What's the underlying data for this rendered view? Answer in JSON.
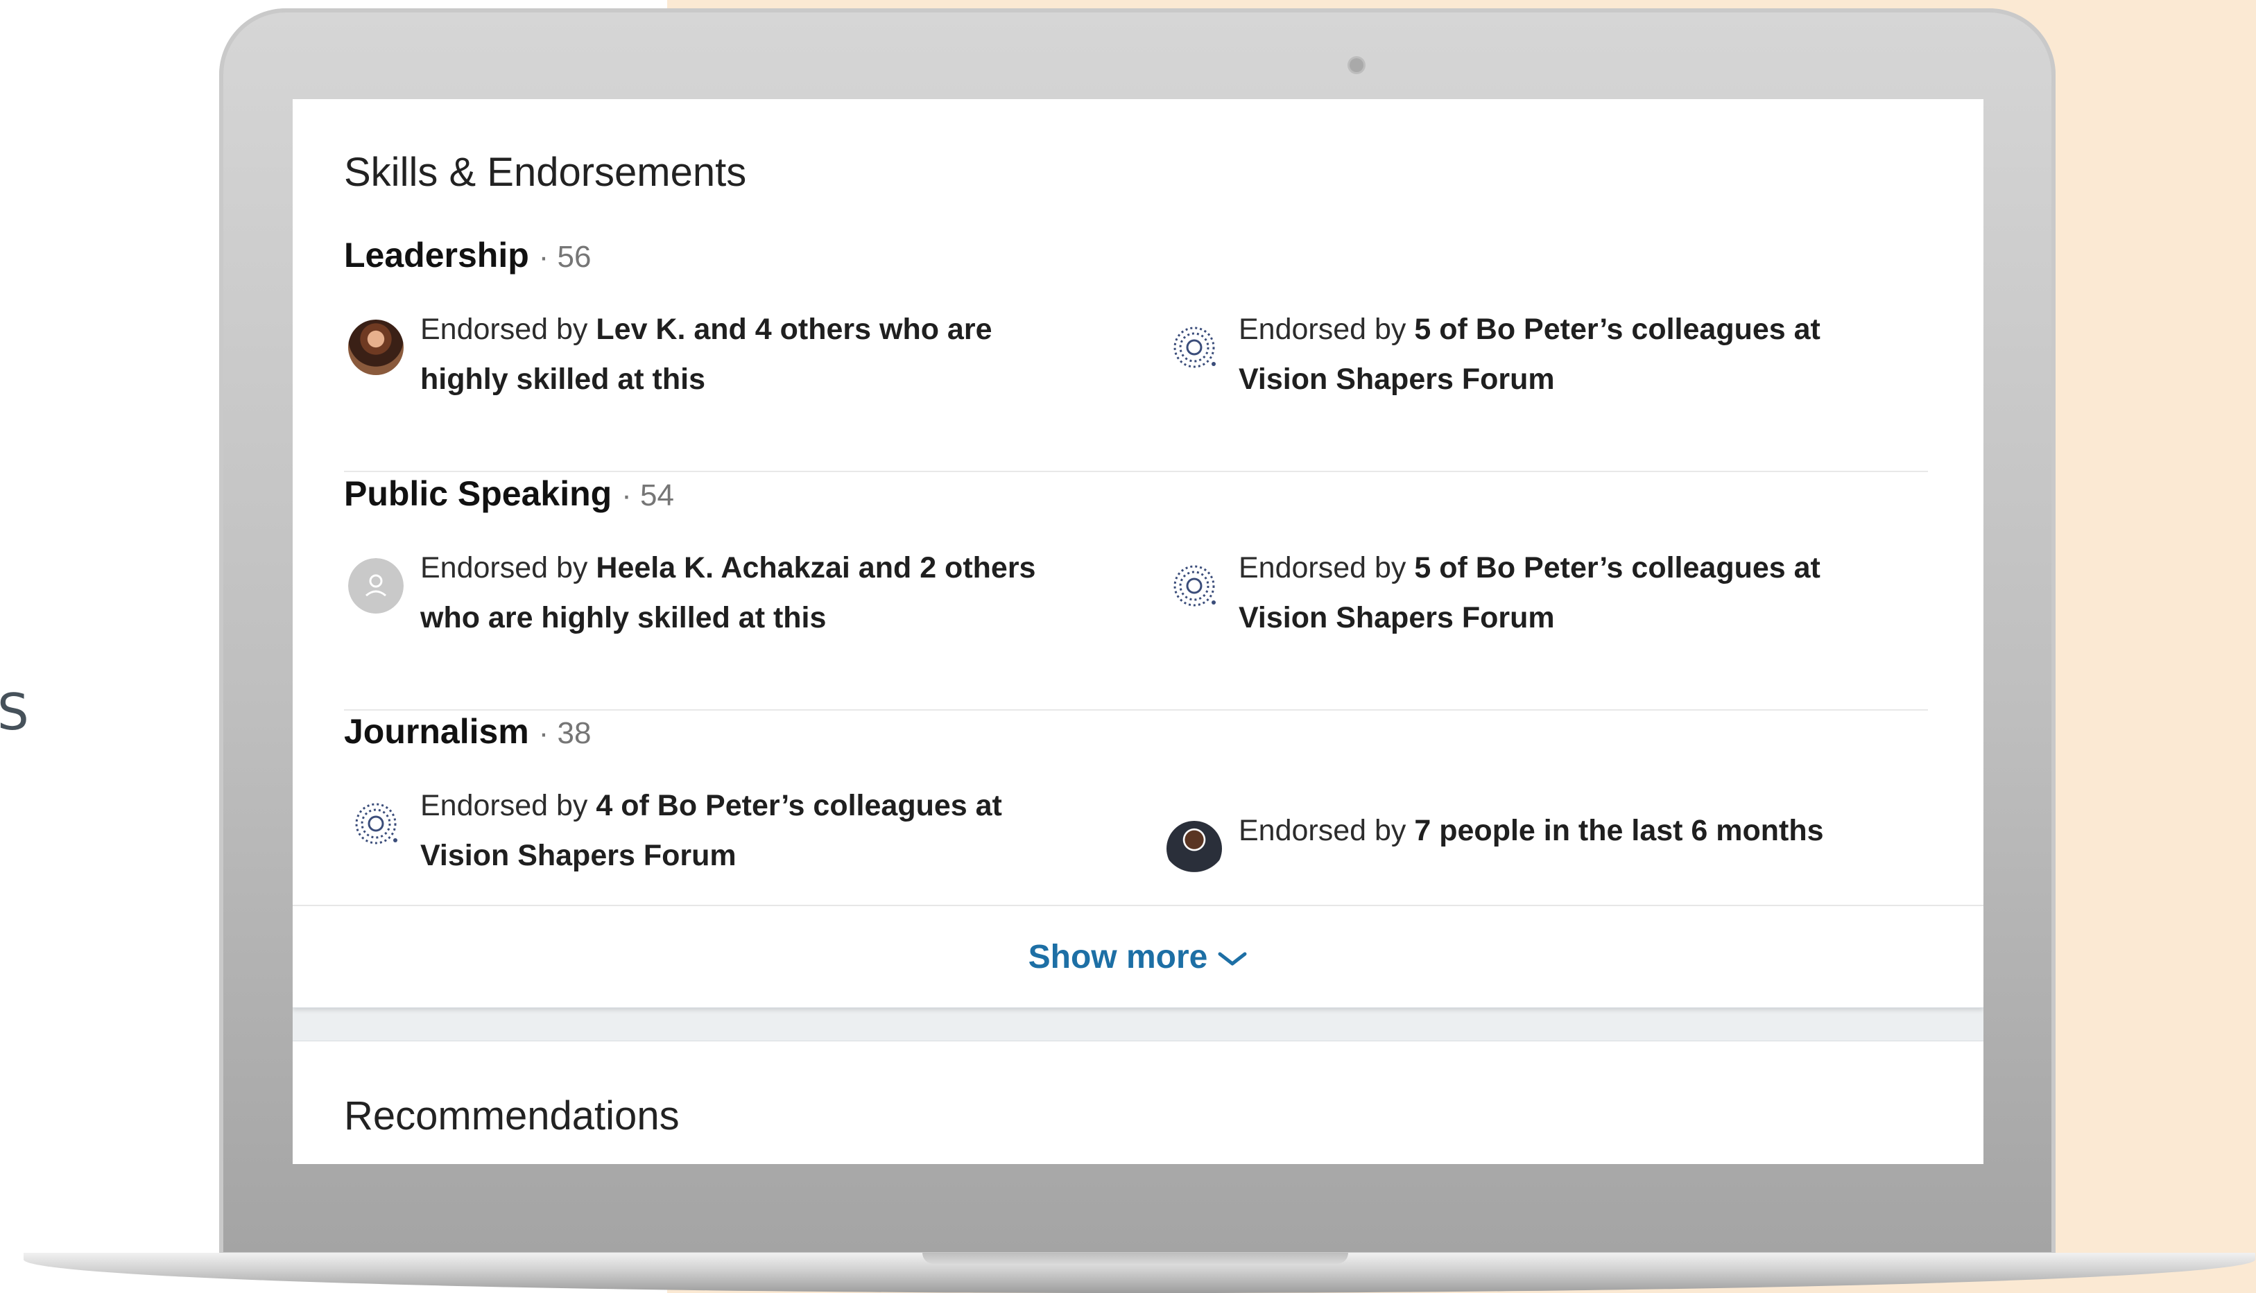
{
  "background": {
    "side_fragment": "S",
    "peach_color": "#fbe9d3"
  },
  "card": {
    "title": "Skills & Endorsements",
    "skills": [
      {
        "name": "Leadership",
        "count": "· 56",
        "left": {
          "prefix": "Endorsed by ",
          "bold": "Lev K. and 4 others who are highly skilled at this",
          "icon": "avatar-photo"
        },
        "right": {
          "prefix": "Endorsed by ",
          "bold": "5 of Bo Peter’s colleagues at Vision Shapers Forum",
          "icon": "company-logo-icon"
        }
      },
      {
        "name": "Public Speaking",
        "count": "· 54",
        "left": {
          "prefix": "Endorsed by ",
          "bold": "Heela K. Achakzai and 2 others who are highly skilled at this",
          "icon": "default-avatar-icon"
        },
        "right": {
          "prefix": "Endorsed by ",
          "bold": "5 of Bo Peter’s colleagues at Vision Shapers Forum",
          "icon": "company-logo-icon"
        }
      },
      {
        "name": "Journalism",
        "count": "· 38",
        "left": {
          "prefix": "Endorsed by ",
          "bold": "4 of Bo Peter’s colleagues at Vision Shapers Forum",
          "icon": "company-logo-icon"
        },
        "right": {
          "prefix": "Endorsed by ",
          "bold": "7 people in the last 6 months",
          "icon": "avatar-photo"
        }
      }
    ],
    "show_more": "Show more",
    "accent_color": "#1d6fa5"
  },
  "recommendations": {
    "title": "Recommendations"
  }
}
